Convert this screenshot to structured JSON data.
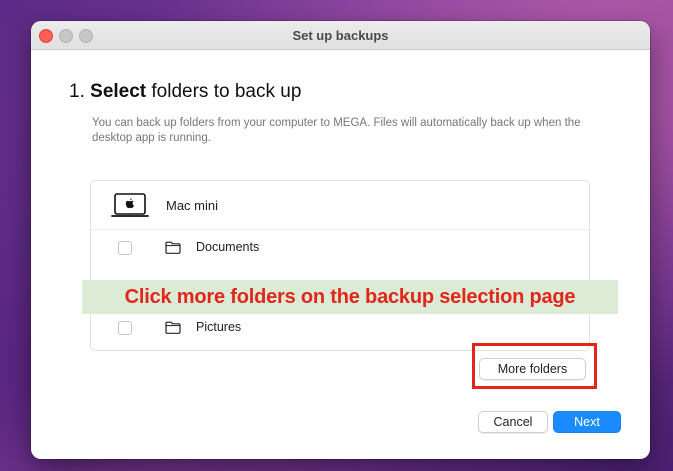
{
  "window": {
    "title": "Set up backups"
  },
  "step": {
    "number": "1.",
    "emphasis": "Select",
    "rest": "folders to back up",
    "description": "You can back up folders from your computer to MEGA. Files will automatically back up when the desktop app is running."
  },
  "device": {
    "name": "Mac mini",
    "icon": "laptop-apple-icon"
  },
  "folders": [
    {
      "label": "Documents",
      "checked": false,
      "icon": "folder-icon"
    },
    {
      "label": "Pictures",
      "checked": false,
      "icon": "folder-icon"
    }
  ],
  "annotation": {
    "text": "Click more folders on the backup selection page",
    "color": "#e3261a",
    "background": "#dcebd6"
  },
  "buttons": {
    "more_folders": "More folders",
    "cancel": "Cancel",
    "next": "Next"
  },
  "colors": {
    "accent": "#1a8cff",
    "close": "#ff5f57"
  }
}
